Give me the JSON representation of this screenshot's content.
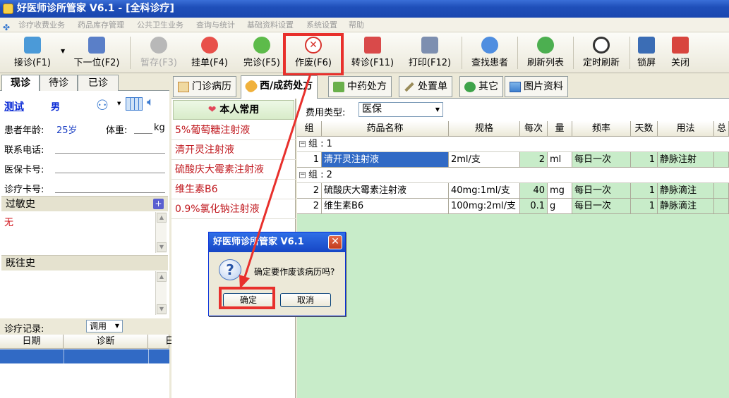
{
  "window": {
    "title": "好医师诊所管家 V6.1 - [全科诊疗]"
  },
  "menu": [
    "诊疗收费业务",
    "药品库存管理",
    "公共卫生业务",
    "查询与统计",
    "基础资料设置",
    "系统设置",
    "帮助"
  ],
  "toolbar": {
    "jiezhen": "接诊(F1)",
    "next": "下一位(F2)",
    "zancun": "暂存(F3)",
    "guadan": "挂单(F4)",
    "wanzhen": "完诊(F5)",
    "zuofei": "作废(F6)",
    "zhuanzhen": "转诊(F11)",
    "print": "打印(F12)",
    "find": "查找患者",
    "refresh": "刷新列表",
    "timed": "定时刷新",
    "lock": "锁屏",
    "close": "关闭"
  },
  "left_tabs": [
    "现诊",
    "待诊",
    "已诊"
  ],
  "patient": {
    "name": "测试",
    "gender": "男",
    "age_label": "患者年龄:",
    "age": "25岁",
    "weight_label": "体重:",
    "weight_unit": "kg",
    "phone_label": "联系电话:",
    "insurance_label": "医保卡号:",
    "card_label": "诊疗卡号:"
  },
  "allergy": {
    "label": "过敏史",
    "value": "无"
  },
  "history": {
    "label": "既往史"
  },
  "records": {
    "label": "诊疗记录:",
    "dropdown": "调用",
    "columns": [
      "日期",
      "诊断",
      "日"
    ]
  },
  "right_tabs": [
    "门诊病历",
    "西/成药处方",
    "中药处方",
    "处置单",
    "其它",
    "图片资料"
  ],
  "favorites": {
    "header": "本人常用",
    "items": [
      "5%葡萄糖注射液",
      "清开灵注射液",
      "硫酸庆大霉素注射液",
      "维生素B6",
      "0.9%氯化钠注射液"
    ]
  },
  "fee": {
    "label": "费用类型:",
    "value": "医保"
  },
  "rx_columns": [
    "组",
    "药品名称",
    "规格",
    "每次",
    "量",
    "频率",
    "天数",
    "用法",
    "总"
  ],
  "groups": [
    {
      "label": "组 : 1",
      "rows": [
        {
          "grp": "1",
          "name": "清开灵注射液",
          "spec": "2ml/支",
          "dose": "2",
          "unit": "ml",
          "freq": "每日一次",
          "days": "1",
          "usage": "静脉注射"
        }
      ]
    },
    {
      "label": "组 : 2",
      "rows": [
        {
          "grp": "2",
          "name": "硫酸庆大霉素注射液",
          "spec": "40mg:1ml/支",
          "dose": "40",
          "unit": "mg",
          "freq": "每日一次",
          "days": "1",
          "usage": "静脉滴注"
        },
        {
          "grp": "2",
          "name": "维生素B6",
          "spec": "100mg:2ml/支",
          "dose": "0.1",
          "unit": "g",
          "freq": "每日一次",
          "days": "1",
          "usage": "静脉滴注"
        }
      ]
    }
  ],
  "dialog": {
    "title": "好医师诊所管家 V6.1",
    "message": "确定要作废该病历吗?",
    "ok": "确定",
    "cancel": "取消"
  }
}
